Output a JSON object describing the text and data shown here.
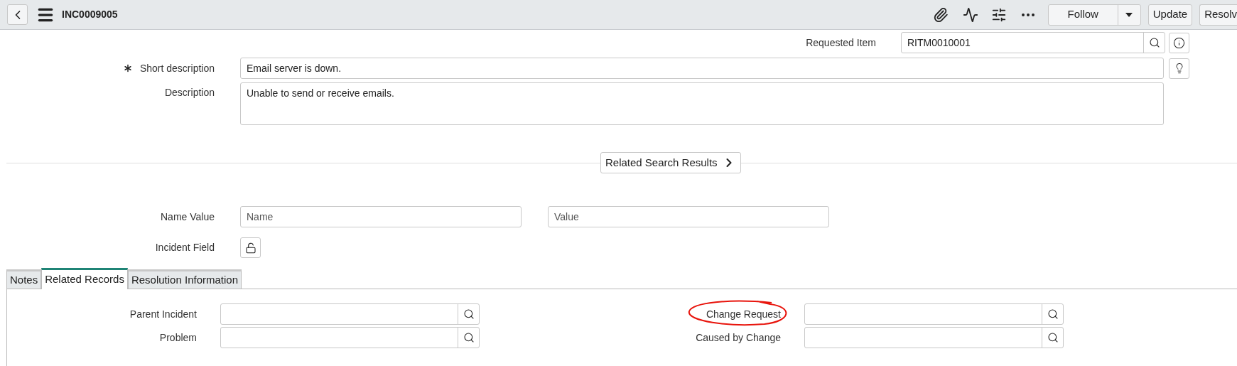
{
  "header": {
    "title": "INC0009005",
    "follow": "Follow",
    "update": "Update",
    "resolve": "Resolv"
  },
  "form": {
    "requested_item": {
      "label": "Requested Item",
      "value": "RITM0010001"
    },
    "short_description": {
      "label": "Short description",
      "value": "Email server is down.",
      "required": true
    },
    "description": {
      "label": "Description",
      "value": "Unable to send or receive emails."
    },
    "related_search": "Related Search Results",
    "name_value": {
      "label": "Name Value",
      "name_placeholder": "Name",
      "value_placeholder": "Value"
    },
    "incident_field": {
      "label": "Incident Field"
    }
  },
  "tabs": [
    {
      "label": "Notes",
      "selected": false
    },
    {
      "label": "Related Records",
      "selected": true
    },
    {
      "label": "Resolution Information",
      "selected": false
    }
  ],
  "related_records": {
    "left": [
      {
        "label": "Parent Incident",
        "circled": false
      },
      {
        "label": "Problem",
        "circled": false
      }
    ],
    "right": [
      {
        "label": "Change Request",
        "circled": true
      },
      {
        "label": "Caused by Change",
        "circled": false
      }
    ]
  }
}
